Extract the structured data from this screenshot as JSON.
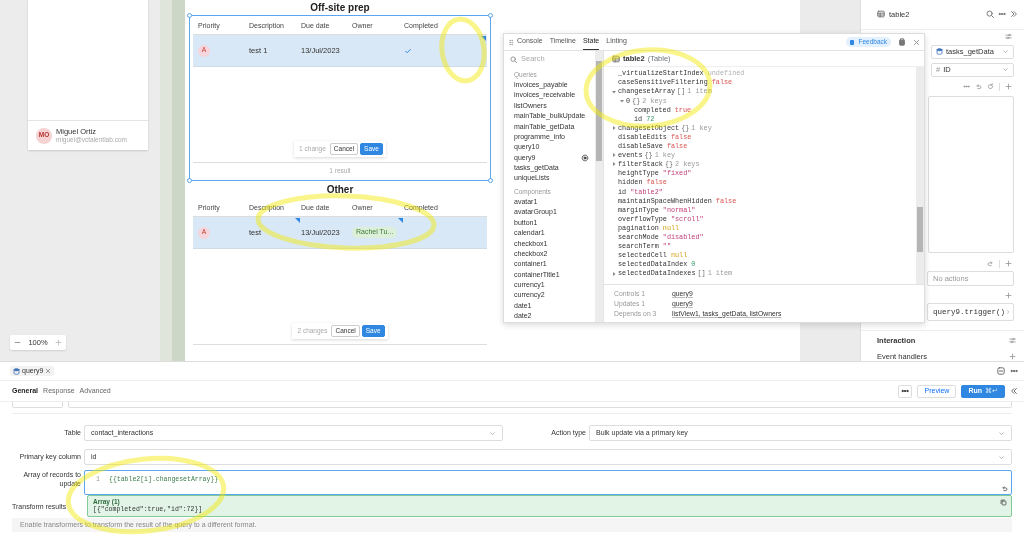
{
  "user_card": {
    "avatar": "MO",
    "name": "Miguel Ortiz",
    "email": "miguel@vctalentlab.com"
  },
  "zoom": {
    "level": "100%"
  },
  "tables": [
    {
      "title": "Off-site prep",
      "selected": true,
      "columns": [
        "Priority",
        "Description",
        "Due date",
        "Owner",
        "Completed"
      ],
      "rows": [
        {
          "selected": true,
          "cells": [
            {
              "kind": "priority",
              "text": "A"
            },
            {
              "kind": "text",
              "text": "test 1"
            },
            {
              "kind": "text",
              "text": "13/Jul/2023"
            },
            {
              "kind": "empty"
            },
            {
              "kind": "check",
              "changed": true
            }
          ]
        }
      ],
      "changes": {
        "count": "1 change",
        "cancel": "Cancel",
        "save": "Save"
      },
      "footer": "1 result"
    },
    {
      "title": "Other",
      "selected": false,
      "columns": [
        "Priority",
        "Description",
        "Due date",
        "Owner",
        "Completed"
      ],
      "rows": [
        {
          "selected": true,
          "cells": [
            {
              "kind": "priority",
              "text": "A"
            },
            {
              "kind": "text",
              "text": "test",
              "changed": true
            },
            {
              "kind": "text",
              "text": "13/Jul/2023"
            },
            {
              "kind": "tag",
              "text": "Rachel Tu...",
              "changed": true
            },
            {
              "kind": "empty"
            }
          ]
        }
      ],
      "changes": {
        "count": "2 changes",
        "cancel": "Cancel",
        "save": "Save"
      }
    }
  ],
  "debug": {
    "tabs": [
      {
        "label": "Console",
        "selected": false
      },
      {
        "label": "Timeline",
        "selected": false
      },
      {
        "label": "State",
        "selected": true
      },
      {
        "label": "Linting",
        "selected": false
      }
    ],
    "feedback": "Feedback",
    "search": {
      "placeholder": "Search"
    },
    "sections": [
      {
        "title": "Queries",
        "items": [
          {
            "label": "invoices_payable",
            "locate": false
          },
          {
            "label": "invoices_receivable",
            "locate": false
          },
          {
            "label": "listOwners",
            "locate": false
          },
          {
            "label": "mainTable_bulkUpdate",
            "locate": false
          },
          {
            "label": "mainTable_getData",
            "locate": false
          },
          {
            "label": "programme_info",
            "locate": false
          },
          {
            "label": "query10",
            "locate": false
          },
          {
            "label": "query9",
            "locate": true
          },
          {
            "label": "tasks_getData",
            "locate": false
          },
          {
            "label": "uniqueLists",
            "locate": false
          }
        ]
      },
      {
        "title": "Components",
        "items": [
          {
            "label": "avatar1",
            "locate": false
          },
          {
            "label": "avatarGroup1",
            "locate": false
          },
          {
            "label": "button1",
            "locate": false
          },
          {
            "label": "calendar1",
            "locate": false
          },
          {
            "label": "checkbox1",
            "locate": false
          },
          {
            "label": "checkbox2",
            "locate": false
          },
          {
            "label": "container1",
            "locate": false
          },
          {
            "label": "containerTitle1",
            "locate": false
          },
          {
            "label": "currency1",
            "locate": false
          },
          {
            "label": "currency2",
            "locate": false
          },
          {
            "label": "date1",
            "locate": false
          },
          {
            "label": "date2",
            "locate": false
          }
        ]
      }
    ],
    "inspector": {
      "title": "table2",
      "type": "(Table)",
      "lines": [
        {
          "key": "_virtualizeStartIndex",
          "value": "undefined",
          "kind": "undefined"
        },
        {
          "key": "caseSensitiveFiltering",
          "value": "false",
          "kind": "boolean"
        },
        {
          "key": "changesetArray",
          "value": "[]",
          "summary": "1 item",
          "kind": "object",
          "expanded": true,
          "children": [
            {
              "key": "0",
              "value": "{}",
              "summary": "2 keys",
              "kind": "object",
              "expanded": true,
              "children": [
                {
                  "key": "completed",
                  "value": "true",
                  "kind": "boolean"
                },
                {
                  "key": "id",
                  "value": "72",
                  "kind": "number"
                }
              ]
            }
          ]
        },
        {
          "key": "changesetObject",
          "value": "{}",
          "summary": "1 key",
          "kind": "object",
          "expanded": false
        },
        {
          "key": "disableEdits",
          "value": "false",
          "kind": "boolean"
        },
        {
          "key": "disableSave",
          "value": "false",
          "kind": "boolean"
        },
        {
          "key": "events",
          "value": "{}",
          "summary": "1 key",
          "kind": "object",
          "expanded": false
        },
        {
          "key": "filterStack",
          "value": "{}",
          "summary": "2 keys",
          "kind": "object",
          "expanded": false
        },
        {
          "key": "heightType",
          "value": "\"fixed\"",
          "kind": "string"
        },
        {
          "key": "hidden",
          "value": "false",
          "kind": "boolean"
        },
        {
          "key": "id",
          "value": "\"table2\"",
          "kind": "string"
        },
        {
          "key": "maintainSpaceWhenHidden",
          "value": "false",
          "kind": "boolean"
        },
        {
          "key": "marginType",
          "value": "\"normal\"",
          "kind": "string"
        },
        {
          "key": "overflowType",
          "value": "\"scroll\"",
          "kind": "string"
        },
        {
          "key": "pagination",
          "value": "null",
          "kind": "null"
        },
        {
          "key": "searchMode",
          "value": "\"disabled\"",
          "kind": "string"
        },
        {
          "key": "searchTerm",
          "value": "\"\"",
          "kind": "string"
        },
        {
          "key": "selectedCell",
          "value": "null",
          "kind": "null"
        },
        {
          "key": "selectedDataIndex",
          "value": "0",
          "kind": "number"
        },
        {
          "key": "selectedDataIndexes",
          "value": "[]",
          "summary": "1 item",
          "kind": "object",
          "expanded": false
        }
      ]
    },
    "dependencies": [
      {
        "label": "Controls 1",
        "value": "query9"
      },
      {
        "label": "Updates 1",
        "value": "query9"
      },
      {
        "label": "Depends on 3",
        "value": "listView1, tasks_getData, listOwners"
      }
    ]
  },
  "right_panel": {
    "title": "table2",
    "data_source": "tasks_getData",
    "primary_key": {
      "prefix": "#",
      "value": "ID"
    },
    "actions_placeholder": "No actions",
    "handler": "query9.trigger()",
    "section": "Interaction",
    "event_handlers": "Event handlers"
  },
  "query_editor": {
    "tab": "query9",
    "subtabs": [
      {
        "label": "General",
        "selected": true
      },
      {
        "label": "Response",
        "selected": false
      },
      {
        "label": "Advanced",
        "selected": false
      }
    ],
    "preview": "Preview",
    "run": "Run",
    "run_shortcut": "⌘↵",
    "table_field": {
      "label": "Table",
      "value": "contact_interactions"
    },
    "action_field": {
      "label": "Action type",
      "value": "Bulk update via a primary key"
    },
    "key_field": {
      "label": "Primary key column",
      "value": "id"
    },
    "records_field": {
      "label": "Array of records to update",
      "line": "1",
      "code": "{{table2[i].changesetArray}}"
    },
    "result": {
      "title": "Array (1)",
      "value": "[{\"completed\":true,\"id\":72}]"
    },
    "transform": {
      "title": "Transform results",
      "hint": "Enable transformers to transform the result of the query to a different format."
    }
  },
  "highlights": [
    {
      "kind": "completed_cell"
    },
    {
      "kind": "changed_cells"
    },
    {
      "kind": "changeset_state"
    },
    {
      "kind": "records_editor"
    }
  ]
}
